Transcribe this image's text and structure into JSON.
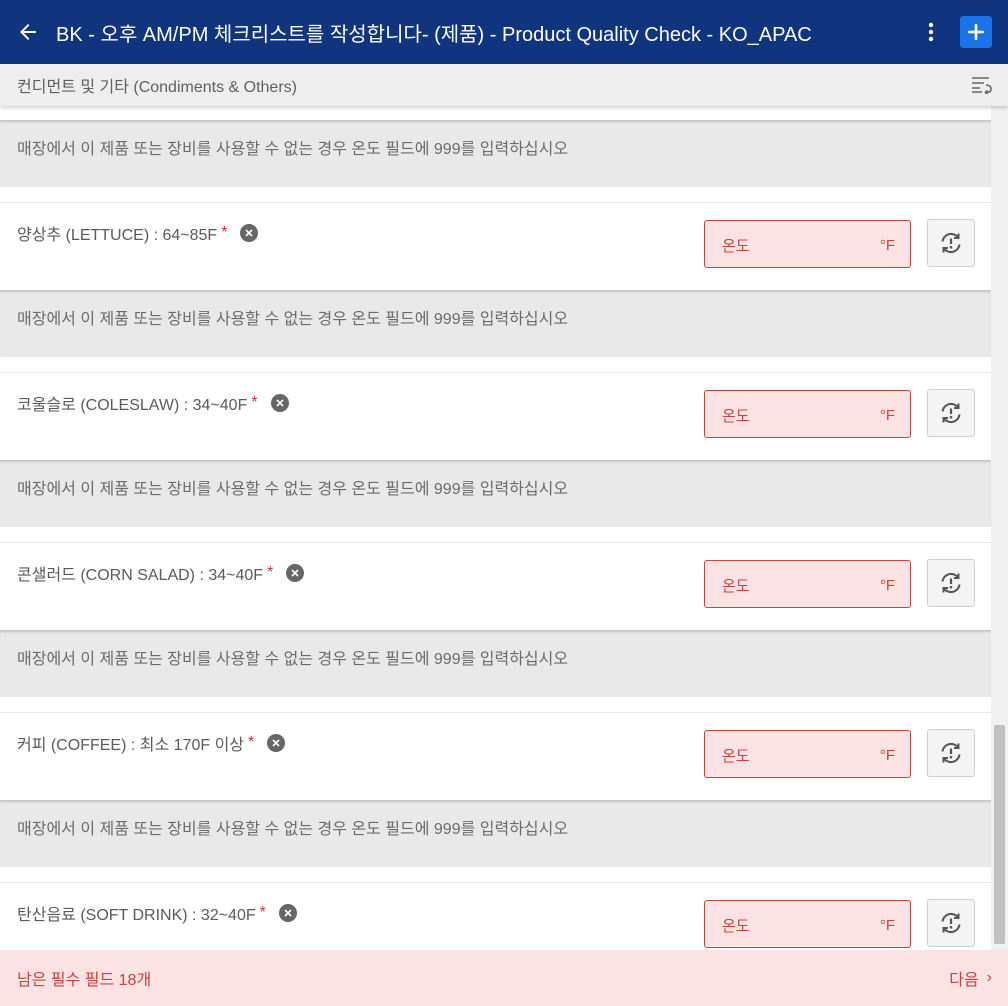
{
  "header": {
    "title": "BK - 오후 AM/PM 체크리스트를 작성합니다- (제품) - Product Quality Check - KO_APAC",
    "bg_color": "#11347f",
    "add_color": "#1a73e8"
  },
  "section": {
    "title": "컨디먼트 및 기타 (Condiments & Others)"
  },
  "info_text": "매장에서 이 제품 또는 장비를 사용할 수 없는 경우 온도 필드에 999를 입력하십시오",
  "items": [
    {
      "label": "양상추 (LETTUCE) : 64~85F",
      "required": "*",
      "placeholder": "온도",
      "unit": "°F"
    },
    {
      "label": "코울슬로 (COLESLAW) : 34~40F",
      "required": "*",
      "placeholder": "온도",
      "unit": "°F"
    },
    {
      "label": "콘샐러드 (CORN SALAD) : 34~40F",
      "required": "*",
      "placeholder": "온도",
      "unit": "°F"
    },
    {
      "label": "커피 (COFFEE) : 최소 170F 이상",
      "required": "*",
      "placeholder": "온도",
      "unit": "°F"
    },
    {
      "label": "탄산음료 (SOFT DRINK) : 32~40F",
      "required": "*",
      "placeholder": "온도",
      "unit": "°F"
    }
  ],
  "footer": {
    "remaining": "남은 필수 필드 18개",
    "next": "다음",
    "next_chevron": "›"
  },
  "icons": {
    "back": "arrow-left-icon",
    "menu": "more-vert-icon",
    "add": "plus-icon",
    "sort": "sort-icon",
    "clear": "close-circle-icon",
    "reset": "reset-icon"
  },
  "colors": {
    "error": "#c9423c",
    "error_bg": "#fbe3e3",
    "required": "#d32f2f"
  }
}
